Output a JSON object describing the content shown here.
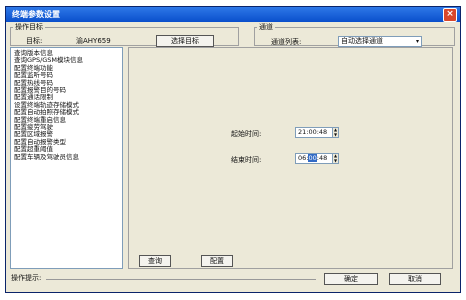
{
  "window": {
    "title": "终端参数设置",
    "close_glyph": "×"
  },
  "target_group": {
    "legend": "操作目标",
    "target_label": "目标:",
    "target_value": "渝AHY659",
    "select_button": "选择目标"
  },
  "channel_group": {
    "legend": "通道",
    "list_label": "通道列表:",
    "selected": "自动选择通道",
    "arrow": "▾"
  },
  "menu_items": [
    "查询版本信息",
    "查询GPS/GSM模块信息",
    "配置终端功能",
    "配置监听号码",
    "配置热线号码",
    "配置报警目的号码",
    "配置通话限制",
    "设置终端轨迹存储模式",
    "配置自动拍照存储模式",
    "配置终端重启信息",
    "配置疲劳驾驶",
    "配置区域报警",
    "配置自动报警类型",
    "配置超重阈值",
    "配置车辆及驾驶员信息"
  ],
  "time_fields": {
    "start_label": "起始时间:",
    "start_value": "21:00:48",
    "end_label": "结束时间:",
    "end_value_pre": "06:",
    "end_value_sel": "00",
    "end_value_post": ":48"
  },
  "buttons": {
    "query": "查询",
    "config": "配置",
    "ok": "确定",
    "cancel": "取消"
  },
  "status": {
    "label": "操作提示:"
  }
}
